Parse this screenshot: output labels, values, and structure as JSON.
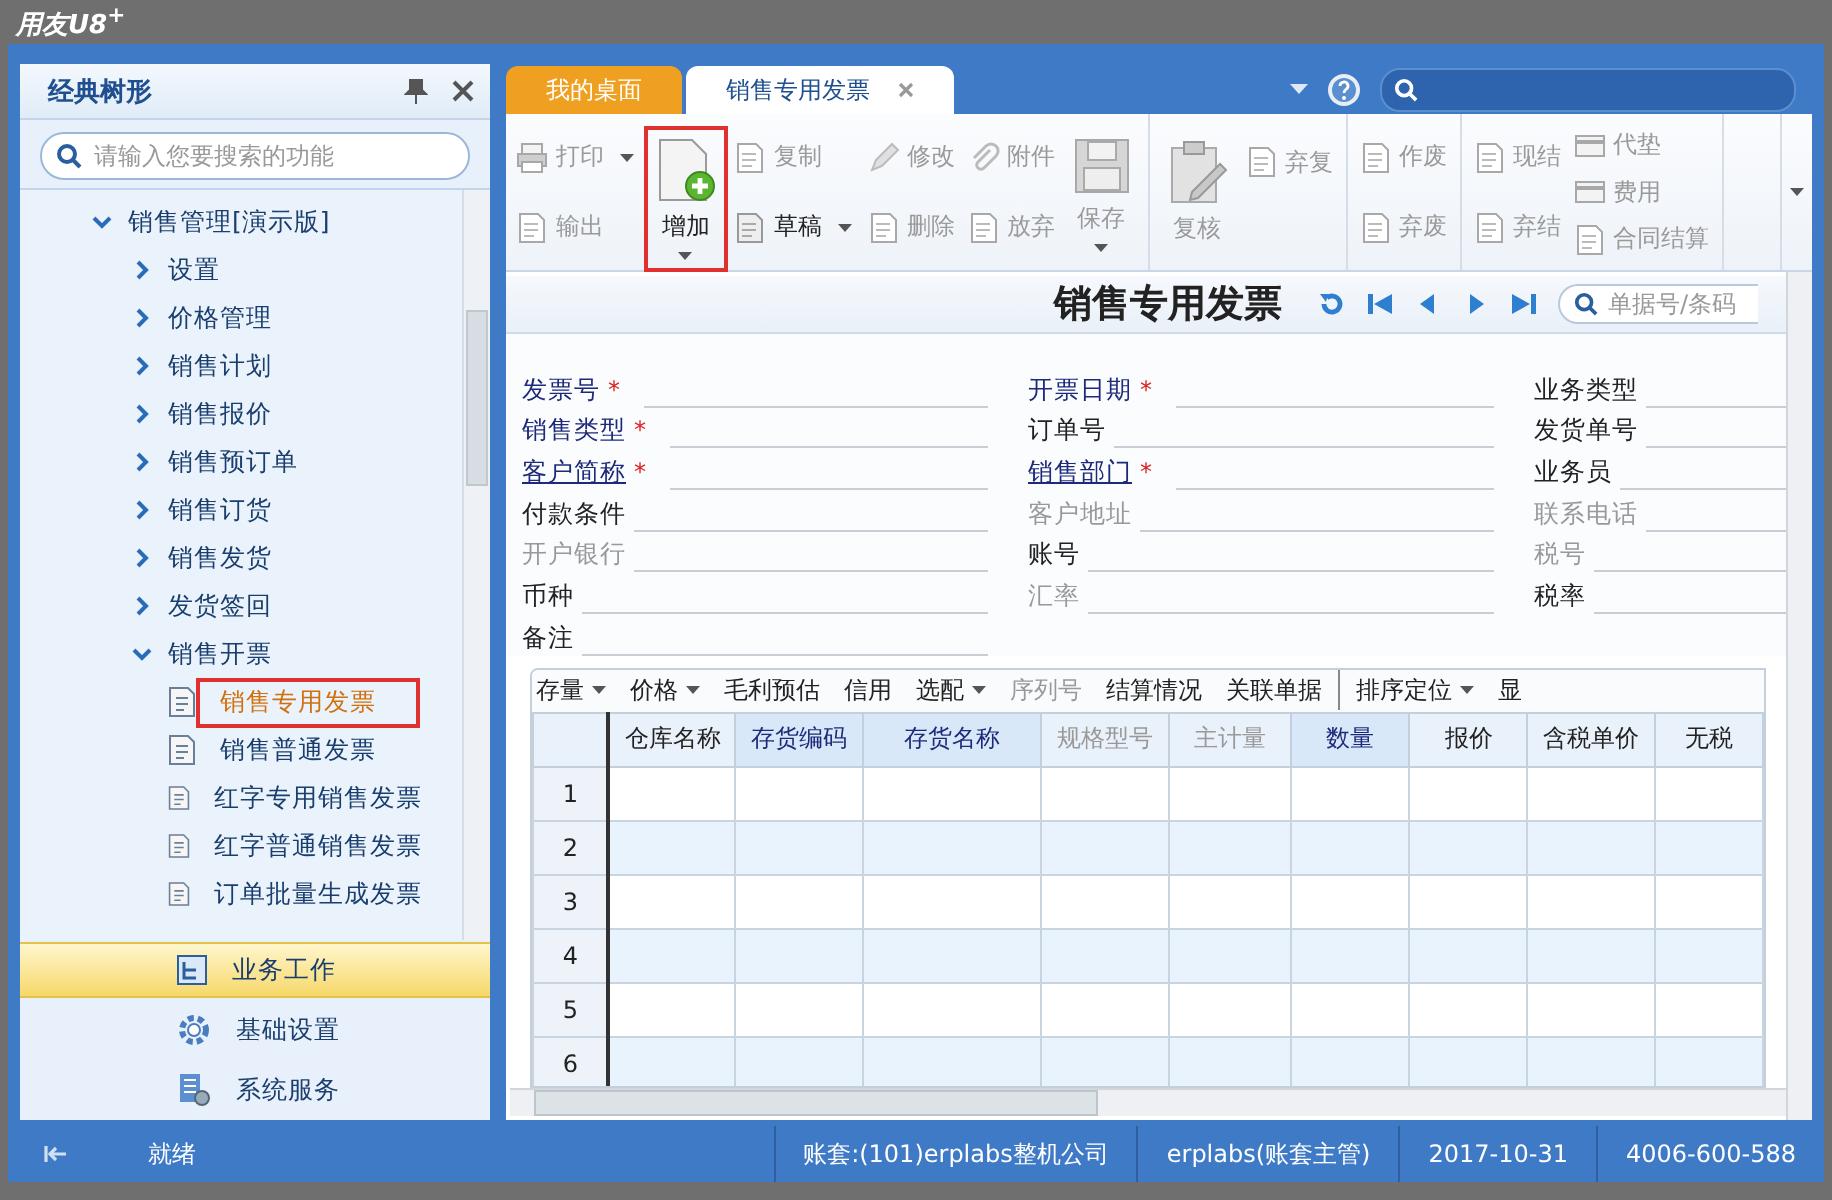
{
  "window": {
    "title": "用友U8$^{+}$"
  },
  "sidebar": {
    "title": "经典树形",
    "search": {
      "placeholder": "请输入您要搜索的功能"
    },
    "tree": [
      {
        "label": "销售管理[演示版]",
        "expanded": true,
        "children": [
          {
            "label": "设置",
            "expanded": false
          },
          {
            "label": "价格管理",
            "expanded": false
          },
          {
            "label": "销售计划",
            "expanded": false
          },
          {
            "label": "销售报价",
            "expanded": false
          },
          {
            "label": "销售预订单",
            "expanded": false
          },
          {
            "label": "销售订货",
            "expanded": false
          },
          {
            "label": "销售发货",
            "expanded": false
          },
          {
            "label": "发货签回",
            "expanded": false
          },
          {
            "label": "销售开票",
            "expanded": true,
            "children": [
              {
                "label": "销售专用发票",
                "selected": true,
                "highlighted": true
              },
              {
                "label": "销售普通发票",
                "selected": false,
                "highlighted": false
              },
              {
                "label": "红字专用销售发票",
                "selected": false,
                "highlighted": false
              },
              {
                "label": "红字普通销售发票",
                "selected": false,
                "highlighted": false
              },
              {
                "label": "订单批量生成发票",
                "selected": false,
                "highlighted": false
              }
            ]
          }
        ]
      }
    ],
    "nav": [
      {
        "label": "业务工作",
        "selected": true
      },
      {
        "label": "基础设置",
        "selected": false
      },
      {
        "label": "系统服务",
        "selected": false
      }
    ]
  },
  "tabs": [
    {
      "label": "我的桌面",
      "selected": false,
      "closable": false
    },
    {
      "label": "销售专用发票",
      "selected": true,
      "closable": true
    }
  ],
  "toolbar": {
    "groups": [
      {
        "columns": [
          [
            {
              "label": "打印",
              "kind": "small",
              "disabled": true,
              "dropdown": true,
              "highlighted": false
            },
            {
              "label": "输出",
              "kind": "small",
              "disabled": true,
              "dropdown": false,
              "highlighted": false
            }
          ],
          [
            {
              "label": "增加",
              "kind": "big",
              "disabled": false,
              "dropdown": true,
              "highlighted": true
            }
          ],
          [
            {
              "label": "复制",
              "kind": "small",
              "disabled": true,
              "dropdown": false,
              "highlighted": false
            },
            {
              "label": "草稿",
              "kind": "small",
              "disabled": false,
              "dropdown": true,
              "highlighted": false
            }
          ],
          [
            {
              "label": "修改",
              "kind": "small",
              "disabled": true,
              "dropdown": false,
              "highlighted": false
            },
            {
              "label": "删除",
              "kind": "small",
              "disabled": true,
              "dropdown": false,
              "highlighted": false
            }
          ],
          [
            {
              "label": "附件",
              "kind": "small",
              "disabled": true,
              "dropdown": false,
              "highlighted": false
            },
            {
              "label": "放弃",
              "kind": "small",
              "disabled": true,
              "dropdown": false,
              "highlighted": false
            }
          ],
          [
            {
              "label": "保存",
              "kind": "big",
              "disabled": true,
              "dropdown": true,
              "highlighted": false
            }
          ]
        ]
      },
      {
        "columns": [
          [
            {
              "label": "复核",
              "kind": "big",
              "disabled": true,
              "dropdown": false,
              "highlighted": false
            }
          ],
          [
            {
              "label": "弃复",
              "kind": "small",
              "disabled": true,
              "dropdown": false,
              "highlighted": false
            }
          ]
        ]
      },
      {
        "columns": [
          [
            {
              "label": "作废",
              "kind": "small",
              "disabled": true,
              "dropdown": false,
              "highlighted": false
            },
            {
              "label": "弃废",
              "kind": "small",
              "disabled": true,
              "dropdown": false,
              "highlighted": false
            }
          ]
        ]
      },
      {
        "columns": [
          [
            {
              "label": "现结",
              "kind": "small",
              "disabled": true,
              "dropdown": false,
              "highlighted": false
            },
            {
              "label": "弃结",
              "kind": "small",
              "disabled": true,
              "dropdown": false,
              "highlighted": false
            }
          ],
          [
            {
              "label": "代垫",
              "kind": "small",
              "disabled": true,
              "dropdown": false,
              "highlighted": false
            },
            {
              "label": "费用",
              "kind": "small",
              "disabled": true,
              "dropdown": false,
              "highlighted": false
            },
            {
              "label": "合同结算",
              "kind": "small",
              "disabled": true,
              "dropdown": false,
              "highlighted": false
            }
          ]
        ]
      }
    ]
  },
  "form": {
    "title": "销售专用发票",
    "search": {
      "placeholder": "单据号/条码"
    },
    "columns": [
      [
        {
          "label": "发票号",
          "marker": "*",
          "link": false,
          "disabled": false
        },
        {
          "label": "销售类型",
          "marker": "*",
          "link": false,
          "disabled": false
        },
        {
          "label": "客户简称",
          "marker": "*",
          "link": true,
          "disabled": false
        },
        {
          "label": "付款条件",
          "link": false,
          "disabled": false
        },
        {
          "label": "开户银行",
          "link": false,
          "disabled": true
        },
        {
          "label": "币种",
          "link": false,
          "disabled": false
        },
        {
          "label": "备注",
          "link": false,
          "disabled": false
        }
      ],
      [
        {
          "label": "开票日期",
          "marker": "*",
          "link": false,
          "disabled": false
        },
        {
          "label": "订单号",
          "link": false,
          "disabled": false
        },
        {
          "label": "销售部门",
          "marker": "*",
          "link": true,
          "disabled": false
        },
        {
          "label": "客户地址",
          "link": false,
          "disabled": true
        },
        {
          "label": "账号",
          "link": false,
          "disabled": false
        },
        {
          "label": "汇率",
          "link": false,
          "disabled": true
        }
      ],
      [
        {
          "label": "业务类型",
          "link": false,
          "disabled": false
        },
        {
          "label": "发货单号",
          "link": false,
          "disabled": false
        },
        {
          "label": "业务员",
          "link": false,
          "disabled": false
        },
        {
          "label": "联系电话",
          "link": false,
          "disabled": true
        },
        {
          "label": "税号",
          "link": false,
          "disabled": true
        },
        {
          "label": "税率",
          "link": false,
          "disabled": false
        }
      ]
    ]
  },
  "grid_toolbar": [
    {
      "label": "存量",
      "dropdown": true,
      "disabled": false,
      "separator_before": false
    },
    {
      "label": "价格",
      "dropdown": true,
      "disabled": false,
      "separator_before": false
    },
    {
      "label": "毛利预估",
      "dropdown": false,
      "disabled": false,
      "separator_before": false
    },
    {
      "label": "信用",
      "dropdown": false,
      "disabled": false,
      "separator_before": false
    },
    {
      "label": "选配",
      "dropdown": true,
      "disabled": false,
      "separator_before": false
    },
    {
      "label": "序列号",
      "dropdown": false,
      "disabled": true,
      "separator_before": false
    },
    {
      "label": "结算情况",
      "dropdown": false,
      "disabled": false,
      "separator_before": false
    },
    {
      "label": "关联单据",
      "dropdown": false,
      "disabled": false,
      "separator_before": false
    },
    {
      "label": "排序定位",
      "dropdown": true,
      "disabled": false,
      "separator_before": true
    },
    {
      "label": "显",
      "dropdown": false,
      "disabled": false,
      "separator_before": false
    }
  ],
  "table": {
    "columns": [
      {
        "label": "仓库名称",
        "required": false,
        "disabled": false
      },
      {
        "label": "存货编码",
        "required": true,
        "disabled": false
      },
      {
        "label": "存货名称",
        "required": true,
        "disabled": false
      },
      {
        "label": "规格型号",
        "required": false,
        "disabled": true
      },
      {
        "label": "主计量",
        "required": false,
        "disabled": true
      },
      {
        "label": "数量",
        "required": true,
        "disabled": false
      },
      {
        "label": "报价",
        "required": false,
        "disabled": false
      },
      {
        "label": "含税单价",
        "required": false,
        "disabled": false
      },
      {
        "label": "无税",
        "required": false,
        "disabled": false
      }
    ],
    "rows": [
      "1",
      "2",
      "3",
      "4",
      "5",
      "6"
    ]
  },
  "status_bar": {
    "message": "就绪",
    "segments": [
      "账套:(101)erplabs整机公司",
      "erplabs(账套主管)",
      "2017-10-31",
      "4006-600-588"
    ]
  }
}
